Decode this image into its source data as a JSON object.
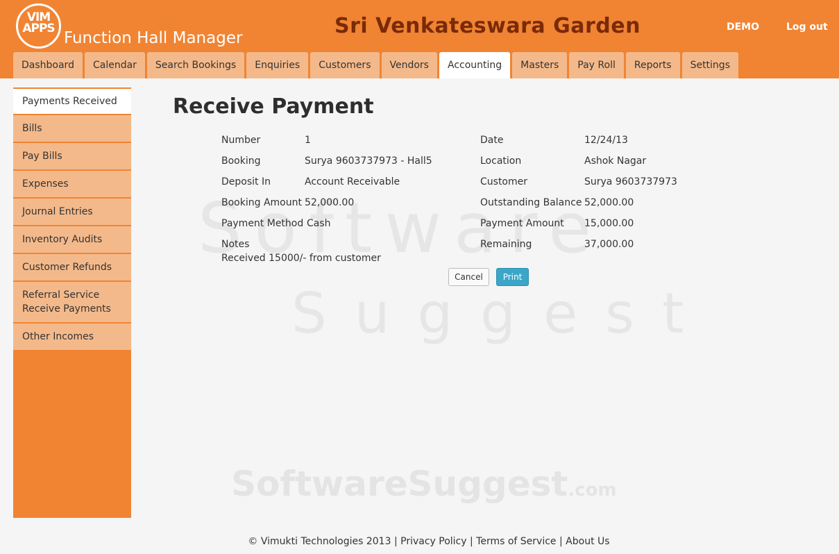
{
  "header": {
    "logo_text": "VIM APPS",
    "app_name": "Function Hall Manager",
    "venue_name": "Sri Venkateswara Garden",
    "demo_label": "DEMO",
    "logout_label": "Log out"
  },
  "tabs": [
    {
      "label": "Dashboard"
    },
    {
      "label": "Calendar"
    },
    {
      "label": "Search Bookings"
    },
    {
      "label": "Enquiries"
    },
    {
      "label": "Customers"
    },
    {
      "label": "Vendors"
    },
    {
      "label": "Accounting",
      "active": true
    },
    {
      "label": "Masters"
    },
    {
      "label": "Pay Roll"
    },
    {
      "label": "Reports"
    },
    {
      "label": "Settings"
    }
  ],
  "sidebar": {
    "items": [
      {
        "label": "Payments Received",
        "active": true
      },
      {
        "label": "Bills"
      },
      {
        "label": "Pay Bills"
      },
      {
        "label": "Expenses"
      },
      {
        "label": "Journal Entries"
      },
      {
        "label": "Inventory Audits"
      },
      {
        "label": "Customer Refunds"
      },
      {
        "label": "Referral Service Receive Payments"
      },
      {
        "label": "Other Incomes"
      }
    ]
  },
  "page": {
    "title": "Receive Payment"
  },
  "form": {
    "number_label": "Number",
    "number_value": "1",
    "date_label": "Date",
    "date_value": "12/24/13",
    "booking_label": "Booking",
    "booking_value": "Surya 9603737973 - Hall5",
    "location_label": "Location",
    "location_value": "Ashok Nagar",
    "deposit_label": "Deposit In",
    "deposit_value": "Account Receivable",
    "customer_label": "Customer",
    "customer_value": "Surya 9603737973",
    "booking_amount_label": "Booking Amount",
    "booking_amount_value": "52,000.00",
    "outstanding_label": "Outstanding Balance",
    "outstanding_value": "52,000.00",
    "payment_method_label": "Payment Method",
    "payment_method_value": "Cash",
    "payment_amount_label": "Payment Amount",
    "payment_amount_value": "15,000.00",
    "notes_label": "Notes",
    "notes_value": "Received 15000/- from customer",
    "remaining_label": "Remaining",
    "remaining_value": "37,000.00"
  },
  "buttons": {
    "cancel_label": "Cancel",
    "print_label": "Print"
  },
  "watermark": {
    "line1": "Software",
    "line2": "Suggest",
    "bottom": "SoftwareSuggest",
    "bottom_suffix": ".com"
  },
  "footer": {
    "copyright": "© Vimukti Technologies 2013",
    "sep1": "|",
    "privacy": "Privacy Policy",
    "sep2": "|",
    "terms": "Terms of Service",
    "sep3": "|",
    "about": "About Us"
  },
  "colors": {
    "brand_orange": "#f08433",
    "tab_light": "#f4b98a",
    "title_brown": "#7a2a08",
    "print_blue": "#3aa6c8"
  }
}
